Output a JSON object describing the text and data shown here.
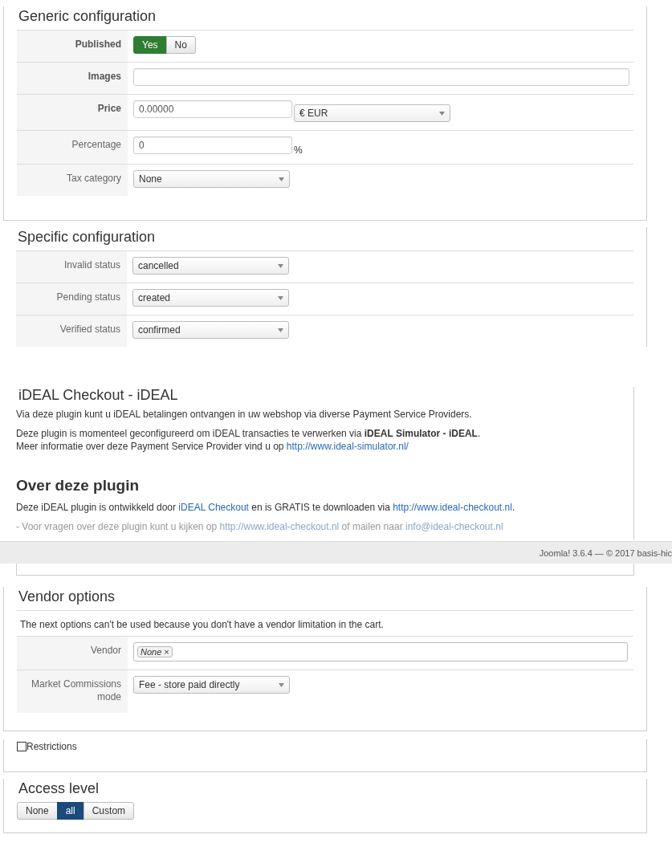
{
  "generic": {
    "title": "Generic configuration",
    "fields": [
      {
        "kind": "toggle",
        "label": "Published",
        "emphasized": true,
        "options": [
          {
            "label": "Yes",
            "selected": true
          },
          {
            "label": "No",
            "selected": false
          }
        ]
      },
      {
        "kind": "text",
        "label": "Images",
        "emphasized": true
      },
      {
        "kind": "price",
        "label": "Price",
        "emphasized": true,
        "value": "0.00000",
        "currency": "€ EUR"
      },
      {
        "kind": "percent",
        "label": "Percentage",
        "emphasized": false,
        "value": "0",
        "unit": "%"
      },
      {
        "kind": "select",
        "label": "Tax category",
        "emphasized": false,
        "value": "None"
      }
    ]
  },
  "specific": {
    "title": "Specific configuration",
    "fields": [
      {
        "kind": "select",
        "label": "Invalid status",
        "emphasized": false,
        "value": "cancelled"
      },
      {
        "kind": "select",
        "label": "Pending status",
        "emphasized": false,
        "value": "created"
      },
      {
        "kind": "select",
        "label": "Verified status",
        "emphasized": false,
        "value": "confirmed"
      }
    ]
  },
  "plugin_info": {
    "title": "iDEAL Checkout - iDEAL",
    "intro": [
      {
        "muted": false,
        "lines": [
          [
            {
              "kind": "text",
              "text": "Via deze plugin kunt u iDEAL betalingen ontvangen in uw webshop via diverse Payment Service Providers."
            }
          ]
        ]
      },
      {
        "muted": false,
        "lines": [
          [
            {
              "kind": "text",
              "text": "Deze plugin is momenteel geconfigureerd om iDEAL transacties te verwerken via **iDEAL Simulator - iDEAL**."
            }
          ],
          [
            {
              "kind": "text",
              "text": "Meer informatie over deze Payment Service Provider vind u op "
            },
            {
              "kind": "link",
              "text": "http://www.ideal-simulator.nl/"
            }
          ]
        ]
      }
    ],
    "heading": "Over deze plugin",
    "about": [
      {
        "muted": false,
        "lines": [
          [
            {
              "kind": "text",
              "text": "Deze iDEAL plugin is ontwikkeld door "
            },
            {
              "kind": "link",
              "text": "iDEAL Checkout"
            },
            {
              "kind": "text",
              "text": " en is GRATIS te downloaden via "
            },
            {
              "kind": "link",
              "text": "http://www.ideal-checkout.nl"
            },
            {
              "kind": "text",
              "text": "."
            }
          ]
        ]
      },
      {
        "muted": true,
        "lines": [
          [
            {
              "kind": "text",
              "text": "- Voor vragen over deze plugin kunt u kijken op "
            },
            {
              "kind": "link",
              "text": "http://www.ideal-checkout.nl"
            },
            {
              "kind": "text",
              "text": " of mailen naar "
            },
            {
              "kind": "link",
              "text": "info@ideal-checkout.nl"
            }
          ]
        ]
      }
    ]
  },
  "footer": "Joomla! 3.6.4 — © 2017 basis-hic",
  "vendor": {
    "title": "Vendor options",
    "note": "The next options can't be used because you don't have a vendor limitation in the cart.",
    "fields": [
      {
        "kind": "tags",
        "label": "Vendor",
        "emphasized": false,
        "tags": [
          "None"
        ],
        "remove": "×"
      },
      {
        "kind": "select",
        "label": "Market Commissions mode",
        "emphasized": false,
        "value": "Fee - store paid directly"
      }
    ]
  },
  "restrictions": {
    "label": "Restrictions",
    "checked": false
  },
  "access_level": {
    "title": "Access level",
    "options": [
      {
        "label": "None",
        "selected": false
      },
      {
        "label": "all",
        "selected": true
      },
      {
        "label": "Custom",
        "selected": false
      }
    ]
  }
}
